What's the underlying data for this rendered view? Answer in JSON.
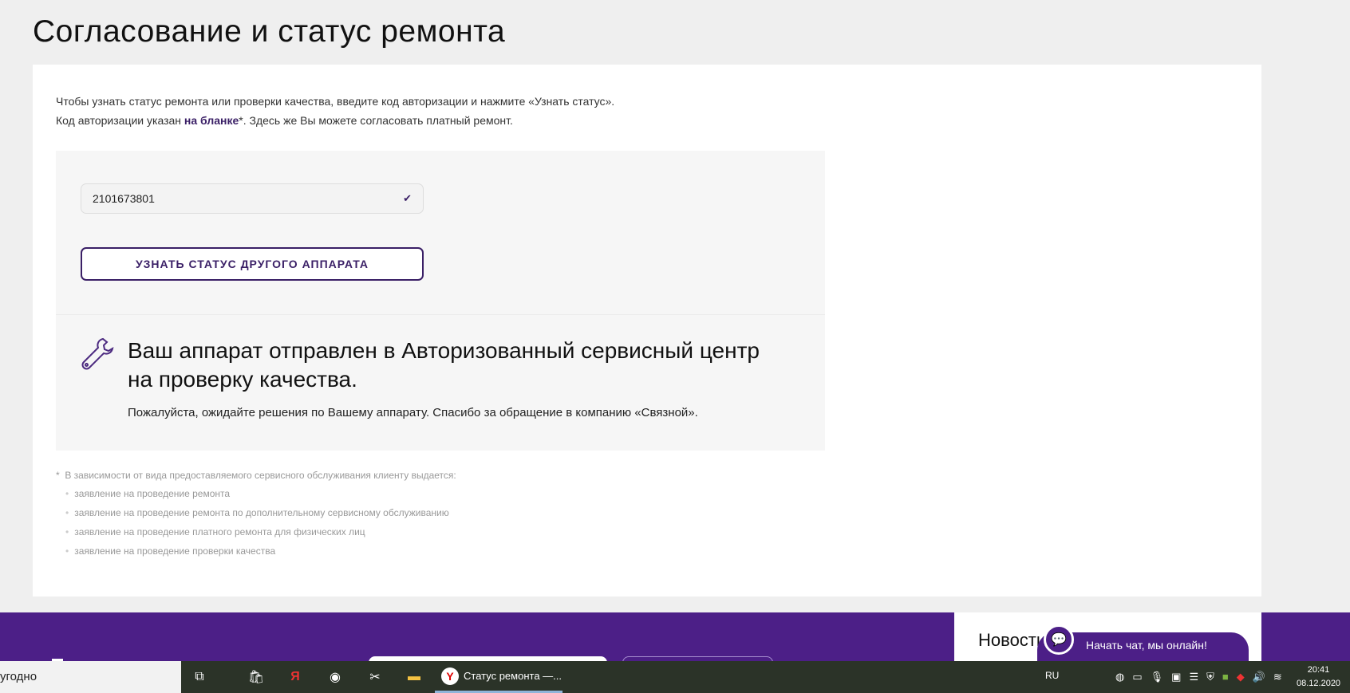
{
  "page": {
    "title": "Согласование и статус ремонта"
  },
  "intro": {
    "line1": "Чтобы узнать статус ремонта или проверки качества, введите код авторизации и нажмите «Узнать статус».",
    "line2_pre": "Код авторизации указан ",
    "line2_link": "на бланке",
    "line2_post": "*. Здесь же Вы можете согласовать платный ремонт."
  },
  "form": {
    "code_value": "2101673801",
    "button_label": "УЗНАТЬ СТАТУС ДРУГОГО АППАРАТА"
  },
  "status": {
    "icon": "wrench-icon",
    "heading": "Ваш аппарат отправлен в Авторизованный сервисный центр на проверку качества.",
    "text": "Пожалуйста, ожидайте решения по Вашему аппарату. Спасибо за обращение в компанию «Связной»."
  },
  "notes": {
    "intro": "В зависимости от вида предоставляемого сервисного обслуживания клиенту выдается:",
    "items": [
      "заявление на проведение ремонта",
      "заявление на проведение ремонта по дополнительному сервисному обслуживанию",
      "заявление на проведение платного ремонта для физических лиц",
      "заявление на проведение проверки качества"
    ]
  },
  "footer": {
    "news_label": "Новости",
    "chat_label": "Начать чат, мы онлайн!"
  },
  "taskbar": {
    "search_text": "угодно",
    "active_app": "Статус ремонта —...",
    "lang": "RU",
    "time": "20:41",
    "date": "08.12.2020"
  },
  "colors": {
    "accent": "#3a1f66",
    "footer": "#4c1f87"
  }
}
